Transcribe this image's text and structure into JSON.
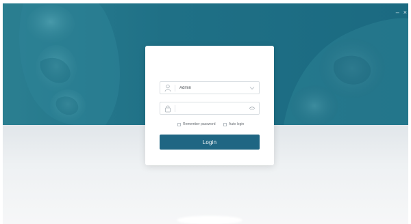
{
  "window": {
    "minimize_glyph": "–",
    "close_glyph": "×"
  },
  "login": {
    "username_value": "Admin",
    "password_value": "",
    "remember_label": "Remember password",
    "autologin_label": "Auto login",
    "button_label": "Login"
  },
  "icons": {
    "user": "user-icon",
    "lock": "lock-icon",
    "dropdown": "chevron-down-icon",
    "show_password": "eye-icon"
  },
  "colors": {
    "hero": "#1f7086",
    "accent": "#1f6683",
    "background": "#eef1f3"
  }
}
